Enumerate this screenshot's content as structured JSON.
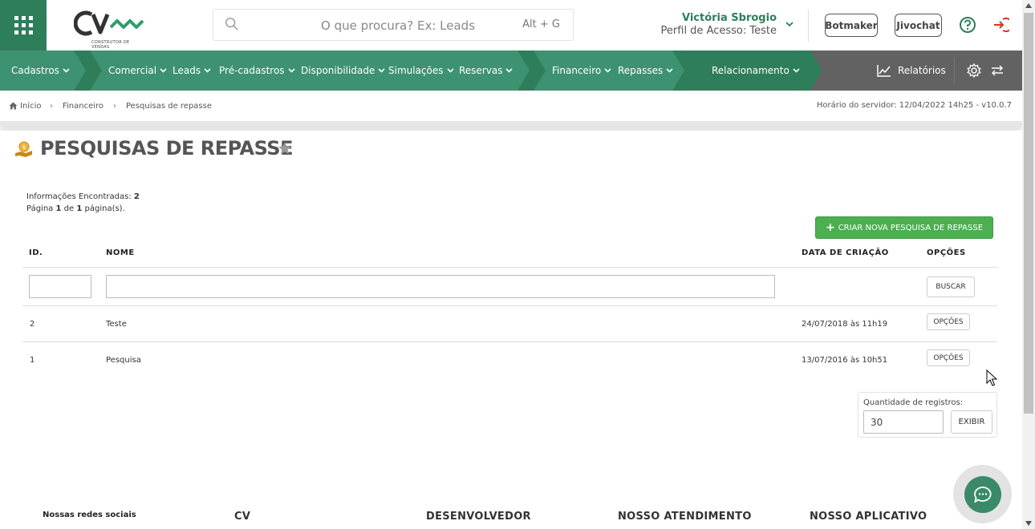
{
  "header": {
    "logo_text": "CONSTRUTOR DE VENDAS",
    "search_placeholder": "O que procura? Ex: Leads",
    "search_shortcut": "Alt + G",
    "user_name": "Victória Sbrogio",
    "user_profile": "Perfil de Acesso: Teste",
    "botmaker_label": "Botmaker",
    "jivochat_label": "Jivochat"
  },
  "nav": {
    "items": [
      {
        "label": "Cadastros"
      },
      {
        "label": "Comercial"
      },
      {
        "label": "Leads"
      },
      {
        "label": "Pré-cadastros"
      },
      {
        "label": "Disponibilidade"
      },
      {
        "label": "Simulações"
      },
      {
        "label": "Reservas"
      },
      {
        "label": "Financeiro"
      },
      {
        "label": "Repasses"
      },
      {
        "label": "Relacionamento"
      }
    ],
    "reports_label": "Relatórios",
    "colors": {
      "dark_green": "#2e7d5b",
      "mid_green": "#3d9272",
      "gray": "#626262"
    }
  },
  "breadcrumb": {
    "items": [
      "Início",
      "Financeiro",
      "Pesquisas de repasse"
    ],
    "server_time": "Horário do servidor: 12/04/2022 14h25 - v10.0.7"
  },
  "page": {
    "title": "PESQUISAS DE REPASSE",
    "info_found_label": "Informações Encontradas:",
    "info_found_count": "2",
    "page_word": "Página",
    "page_current": "1",
    "page_of": "de",
    "page_total": "1",
    "page_suffix": "página(s).",
    "create_button": "CRIAR NOVA PESQUISA DE REPASSE"
  },
  "table": {
    "headers": {
      "id": "ID.",
      "name": "NOME",
      "date": "DATA DE CRIAÇÃO",
      "options": "OPÇÕES"
    },
    "search_button": "BUSCAR",
    "rows": [
      {
        "id": "2",
        "name": "Teste",
        "date": "24/07/2018 às 11h19",
        "options": "OPÇÕES"
      },
      {
        "id": "1",
        "name": "Pesquisa",
        "date": "13/07/2016 às 10h51",
        "options": "OPÇÕES"
      }
    ]
  },
  "pagination": {
    "label": "Quantidade de registros:",
    "value": "30",
    "button": "EXIBIR"
  },
  "footer": {
    "social": "Nossas redes sociais",
    "columns": [
      "CV",
      "DESENVOLVEDOR",
      "NOSSO ATENDIMENTO",
      "NOSSO APLICATIVO"
    ]
  },
  "icons": {
    "apps": "grid-icon",
    "search": "search-icon",
    "help": "help-icon",
    "logout": "logout-icon",
    "home": "home-icon",
    "reports": "chart-line-icon",
    "settings": "gear-icon",
    "switch": "arrows-exchange-icon",
    "title": "money-hand-icon",
    "favorite": "star-icon",
    "chat": "chat-icon"
  }
}
